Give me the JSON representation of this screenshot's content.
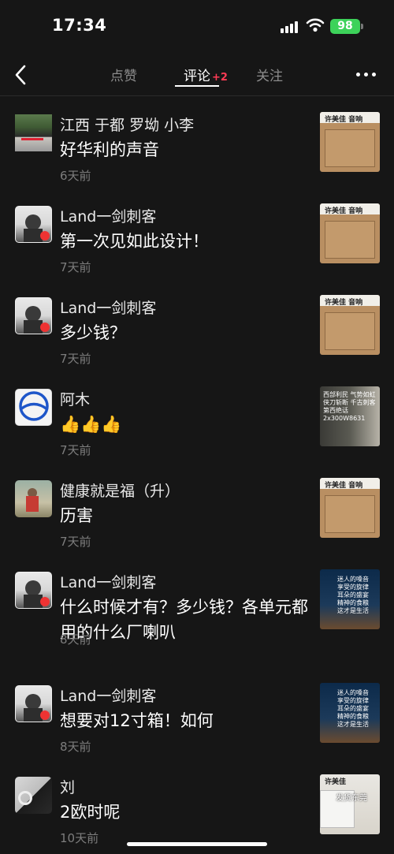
{
  "status_bar": {
    "time": "17:34",
    "battery": "98"
  },
  "nav": {
    "tabs": [
      {
        "label": "点赞"
      },
      {
        "label": "评论",
        "badge": "+2"
      },
      {
        "label": "关注"
      }
    ]
  },
  "comments": [
    {
      "name": "江西   于都   罗坳   小李",
      "text": "好华利的声音",
      "time": "6天前",
      "thumb_label": "许美佳  音响"
    },
    {
      "name": "Land一剑刺客",
      "text": "第一次见如此设计！",
      "time": "7天前",
      "thumb_label": "许美佳  音响"
    },
    {
      "name": "Land一剑刺客",
      "text": "多少钱？",
      "time": "7天前",
      "thumb_label": "许美佳  音响"
    },
    {
      "name": "阿木",
      "text": "👍👍👍",
      "time": "7天前",
      "thumb_text": "西部利民 气势如虹 侠刀斩断 千古刺客 第西绝话 2x300W8631"
    },
    {
      "name": "健康就是福（升）",
      "text": "历害",
      "time": "7天前",
      "thumb_label": "许美佳  音响"
    },
    {
      "name": "Land一剑刺客",
      "text": "什么时候才有？多少钱？各单元都用的什么厂喇叭",
      "time": "8天前",
      "thumb_text": "迷人的嗓音 享受的旋律 耳朵的盛宴 精神的食粮 这才是生活"
    },
    {
      "name": "Land一剑刺客",
      "text": "想要对12寸箱！如何",
      "time": "8天前",
      "thumb_text": "迷人的嗓音 享受的旋律 耳朵的盛宴 精神的食粮 这才是生活"
    },
    {
      "name": "刘",
      "text": "2欧时呢",
      "time": "10天前",
      "thumb_label": "许美佳",
      "thumb_text": "发货东莞"
    }
  ]
}
